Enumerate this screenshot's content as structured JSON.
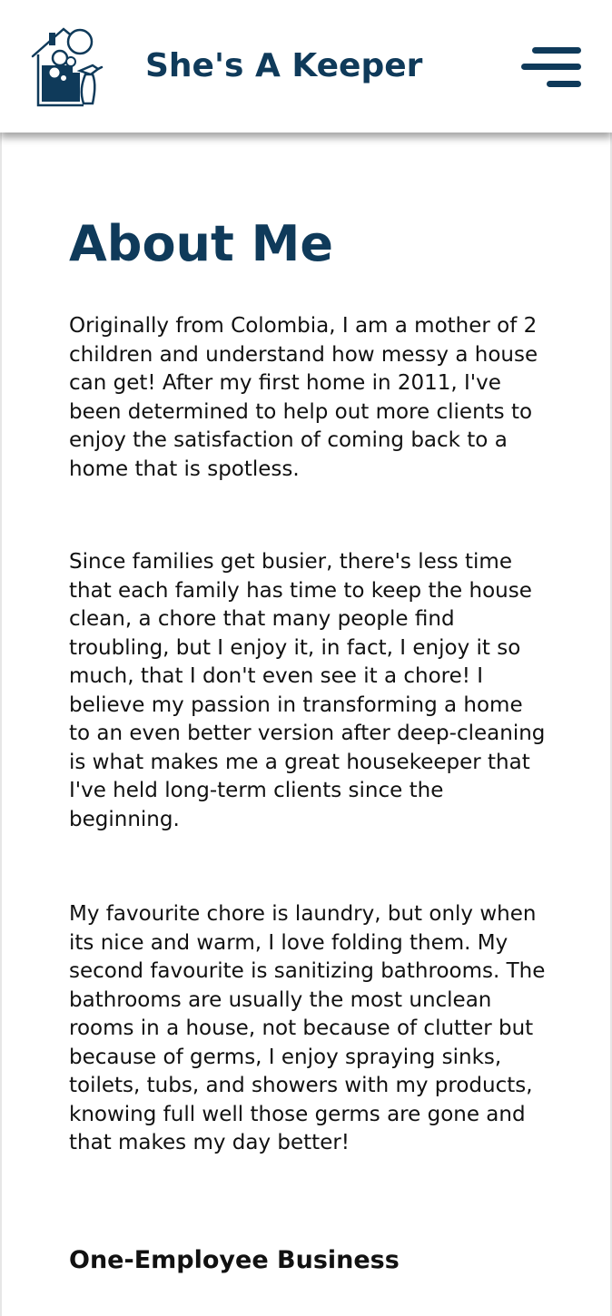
{
  "header": {
    "brand_name": "She's A Keeper",
    "logo_icon": "house-with-bubbles-logo-icon",
    "menu_icon": "hamburger-menu-icon"
  },
  "main": {
    "title": "About Me",
    "paragraphs": [
      "Originally from Colombia, I am a mother of 2 children and understand how messy a house can get! After my first home in 2011, I've been determined to help out more clients to enjoy the satisfaction of coming back to a home that is spotless.",
      "Since families get busier, there's less time that each family has time to keep the house clean, a chore that many people find troubling, but I enjoy it, in fact, I enjoy it so much, that I don't even see it a chore! I believe my passion in transforming a home to an even better version after deep-cleaning is what makes me a great housekeeper that I've held long-term clients since the beginning.",
      "My favourite chore is laundry, but only when its nice and warm, I love folding them. My second favourite is sanitizing bathrooms. The bathrooms are usually the most unclean rooms in a house, not because of clutter but because of germs, I enjoy spraying sinks, toilets, tubs, and showers with my products, knowing full well those germs are gone and that makes my day better!"
    ],
    "section_heading": "One-Employee Business"
  },
  "colors": {
    "brand": "#0f3a5a",
    "text": "#111111",
    "background": "#ffffff"
  }
}
